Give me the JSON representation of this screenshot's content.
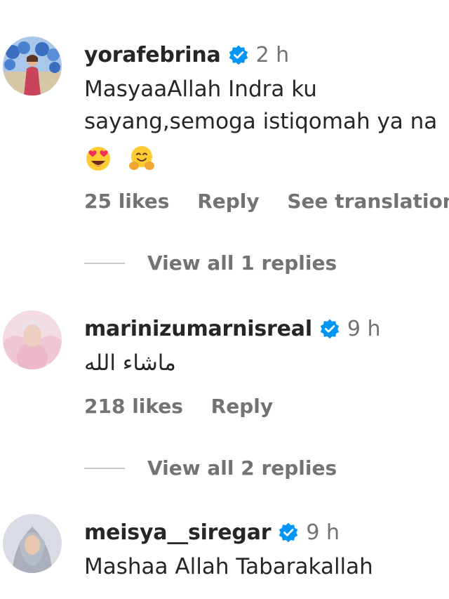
{
  "comments": [
    {
      "username": "yorafebrina",
      "verified": true,
      "time": "2 h",
      "lines": [
        "MasyaaAllah Indra ku",
        "sayang,semoga istiqomah ya na"
      ],
      "emojis": [
        "smiling-face-with-heart-eyes-icon",
        "hugging-face-icon"
      ],
      "likes": "25 likes",
      "reply": "Reply",
      "translate": "See translation",
      "view_replies": "View all 1 replies"
    },
    {
      "username": "marinizumarnisreal",
      "verified": true,
      "time": "9 h",
      "text": "ماشاء الله",
      "likes": "218 likes",
      "reply": "Reply",
      "view_replies": "View all 2 replies"
    },
    {
      "username": "meisya__siregar",
      "verified": true,
      "time": "9 h",
      "text": "Mashaa Allah Tabarakallah"
    }
  ],
  "colors": {
    "text": "#262626",
    "muted": "#737373",
    "verified": "#0095f6"
  }
}
